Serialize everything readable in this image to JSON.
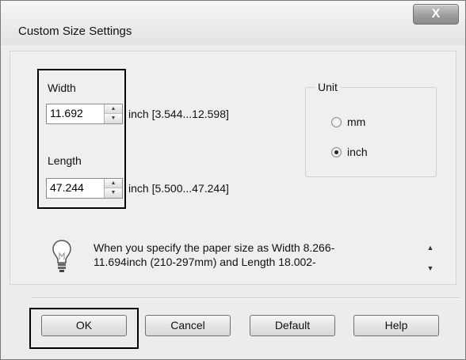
{
  "window": {
    "title": "Custom Size Settings",
    "close_label": "X"
  },
  "size": {
    "width_label": "Width",
    "width_value": "11.692",
    "width_range": "inch [3.544...12.598]",
    "length_label": "Length",
    "length_value": "47.244",
    "length_range": "inch [5.500...47.244]"
  },
  "unit": {
    "legend": "Unit",
    "options": [
      {
        "label": "mm",
        "checked": false
      },
      {
        "label": "inch",
        "checked": true
      }
    ]
  },
  "hint": {
    "icon": "lightbulb-icon",
    "text": "When you specify the paper size as Width 8.266-\n11.694inch (210-297mm) and Length 18.002-"
  },
  "buttons": {
    "ok": "OK",
    "cancel": "Cancel",
    "default": "Default",
    "help": "Help"
  }
}
